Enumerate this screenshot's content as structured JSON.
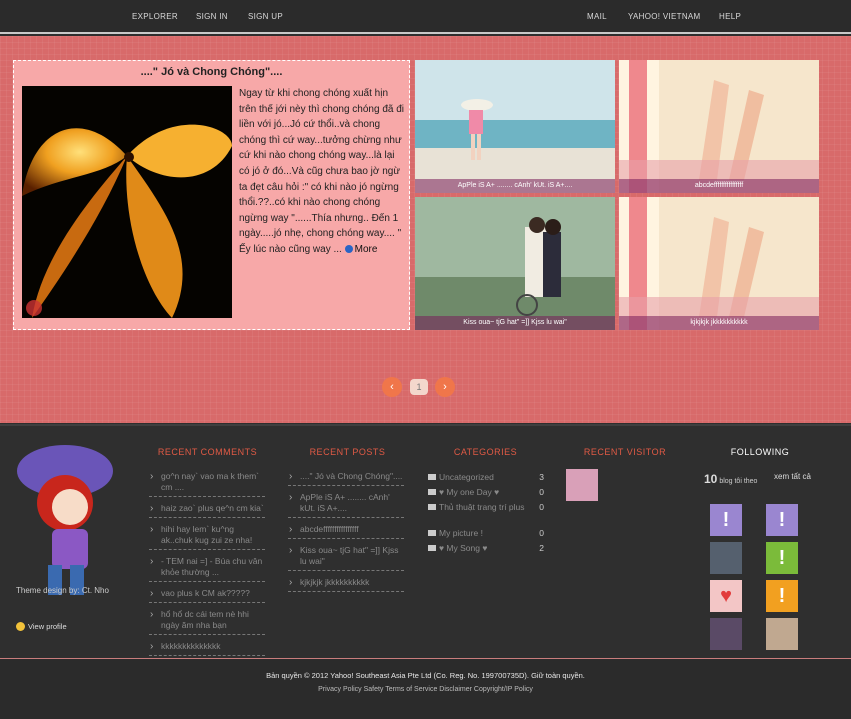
{
  "top_nav": {
    "explorer": "EXPLORER",
    "sign_in": "SIGN IN",
    "sign_up": "SIGN UP",
    "mail": "MAIL",
    "yahoo_vietnam": "YAHOO! VIETNAM",
    "help": "HELP"
  },
  "featured": {
    "title": "....\" Jó và Chong Chóng\"....",
    "text": "Ngay từ khi chong chóng xuất hịn trên thế jới nèy thì chong chóng đã đi liền với jó...Jó cứ thổi..và chong chóng thì cứ way...tưởng chừng như cứ khi nào chong chóng way...là lại có jó ở đó...Và cũg chưa bao jờ ngừ ta đẹt câu hỏi :\" có khi nào jó ngừng thổi.??..có khi nào chong chóng ngừng way \"......Thía nhưng.. Đến 1 ngày.....jó nhẹ, chong chóng way.... \" Ếy lúc nào cũng way ...",
    "more": "More"
  },
  "thumbs": [
    {
      "caption": "ApPle iS A+ ........ cAnh' kUt. iS A+...."
    },
    {
      "caption": "abcdeffffffffffffffff"
    },
    {
      "caption": "Kiss oua~ tjG hat\" =]] Kjss lu wai\""
    },
    {
      "caption": "kjkjkjk jkkkkkkkkkk"
    }
  ],
  "pager": {
    "prev": "‹",
    "page": "1",
    "next": "›"
  },
  "profile": {
    "theme_credit": "Theme design by: Ct. Nho",
    "view_profile": "View profile"
  },
  "recent_comments": {
    "title": "RECENT COMMENTS",
    "items": [
      "go^n nay` vao ma k them` cm ....",
      "haiz zao` plus qe^n cm kia`",
      "hihi hay lem` ku^ng ak..chuk kug zui ze nha!",
      "- TEM nai =] - Búa chu vân khỏe thường ...",
      "vao plus k CM ak?????",
      "hổ hổ dc cái tem nè hhi ngày ăm nha bạn",
      "kkkkkkkkkkkkkk"
    ]
  },
  "recent_posts": {
    "title": "RECENT POSTS",
    "items": [
      "....\" Jó và Chong Chóng\"....",
      "ApPle iS A+ ........ cAnh' kUt. iS A+....",
      "abcdeffffffffffffffff",
      "Kiss oua~ tjG hat\" =]] Kjss lu wai\"",
      "kjkjkjk jkkkkkkkkkk"
    ]
  },
  "categories": {
    "title": "CATEGORIES",
    "items": [
      {
        "name": "Uncategorized",
        "count": "3"
      },
      {
        "name": "♥ My one Day ♥",
        "count": "0"
      },
      {
        "name": "Thủ thuật trang trí plus",
        "count": "0"
      },
      {
        "name": "My picture !",
        "count": "0"
      },
      {
        "name": "♥ My Song ♥",
        "count": "2"
      }
    ]
  },
  "recent_visitor": {
    "title": "RECENT VISITOR"
  },
  "following": {
    "title": "FOLLOWING",
    "count": "10",
    "count_label": "blog tôi theo",
    "see_all": "xem tất cả"
  },
  "footer": {
    "copyright": "Bản quyền © 2012 Yahoo! Southeast Asia Pte Ltd (Co. Reg. No. 199700735D). Giữ toàn quyền.",
    "links": "Privacy Policy Safety Terms of Service Disclaimer Copyright/IP Policy"
  },
  "colors": {
    "accent": "#e05a45",
    "hero_bg": "#d86a6a",
    "featured_bg": "#f7a8a8",
    "dark_bg": "#2f2f2f"
  }
}
